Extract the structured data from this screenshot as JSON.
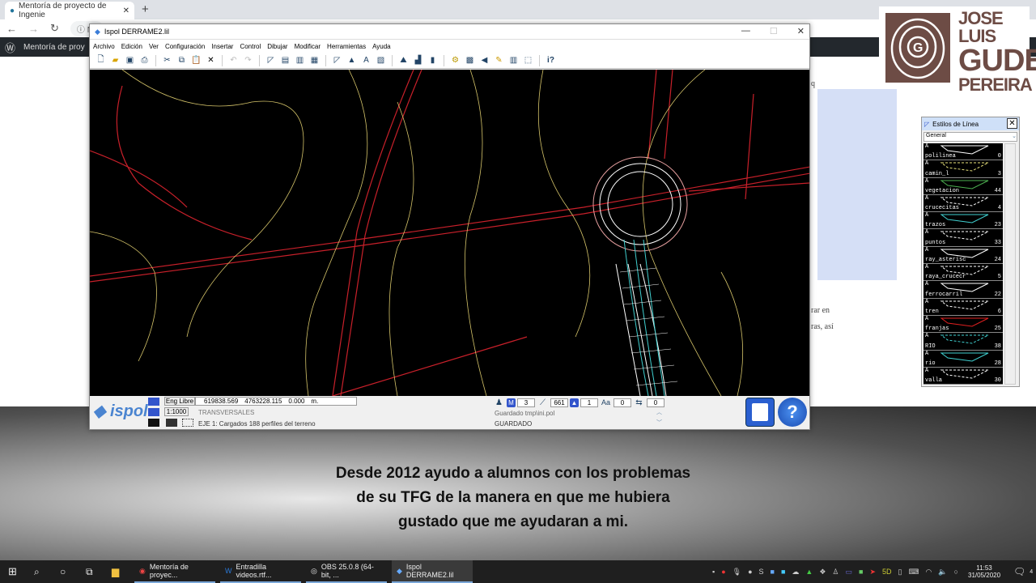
{
  "browser": {
    "tab_title": "Mentoría de proyecto de Ingenie",
    "address": "No",
    "wp_site": "Mentoría de proy"
  },
  "page": {
    "text_right": [
      "rar en",
      "ras, así"
    ],
    "text_top": "q"
  },
  "window": {
    "title": "Ispol  DERRAME2.lil",
    "menu": [
      "Archivo",
      "Edición",
      "Ver",
      "Configuración",
      "Insertar",
      "Control",
      "Dibujar",
      "Modificar",
      "Herramientas",
      "Ayuda"
    ]
  },
  "status": {
    "mode": "Eng Libre",
    "scale": "1:1000",
    "x": "619838.569",
    "y": "4763228.115",
    "z": "0.000",
    "unit": "m.",
    "section": "TRANSVERSALES",
    "message": "EJE 1: Cargados 188 perfiles del terreno",
    "counters": [
      "3",
      "661",
      "1",
      "0",
      "0"
    ],
    "saved_file": "Guardado tmp\\ini.pol",
    "saved_state": "GUARDADO",
    "logo": "ispol"
  },
  "line_styles": {
    "title": "Estilos de Línea",
    "filter": "General",
    "items": [
      {
        "name": "polilinea",
        "count": "0",
        "color": "#ffffff"
      },
      {
        "name": "camin_l",
        "count": "3",
        "color": "#e6e07a"
      },
      {
        "name": "vegetacion",
        "count": "44",
        "color": "#4caf50"
      },
      {
        "name": "crucecitas",
        "count": "4",
        "color": "#ffffff"
      },
      {
        "name": "trazos",
        "count": "23",
        "color": "#40d0d0"
      },
      {
        "name": "puntos",
        "count": "33",
        "color": "#ffffff"
      },
      {
        "name": "ray_asterisc",
        "count": "24",
        "color": "#ffffff"
      },
      {
        "name": "raya_crucecr",
        "count": "5",
        "color": "#ffffff"
      },
      {
        "name": "ferrocarril",
        "count": "22",
        "color": "#ffffff"
      },
      {
        "name": "tren",
        "count": "6",
        "color": "#ffffff"
      },
      {
        "name": "franjas",
        "count": "25",
        "color": "#e02020"
      },
      {
        "name": "RIO",
        "count": "38",
        "color": "#40d0d0"
      },
      {
        "name": "rio",
        "count": "28",
        "color": "#40d0d0"
      },
      {
        "name": "valla",
        "count": "30",
        "color": "#ffffff"
      }
    ]
  },
  "branding": {
    "name_line1": "JOSE LUIS",
    "name_line2": "GUDE",
    "name_line3": "PEREIRA"
  },
  "subtitle": [
    "Desde 2012 ayudo a alumnos con los problemas",
    "de su TFG de la manera en que me hubiera",
    "gustado que me ayudaran a mi."
  ],
  "taskbar": {
    "apps": [
      "Mentoría de proyec...",
      "Entradilla videos.rtf...",
      "OBS 25.0.8 (64-bit, ...",
      "Ispol  DERRAME2.lil"
    ],
    "time": "11:53",
    "date": "31/05/2020",
    "notifications": "4"
  }
}
